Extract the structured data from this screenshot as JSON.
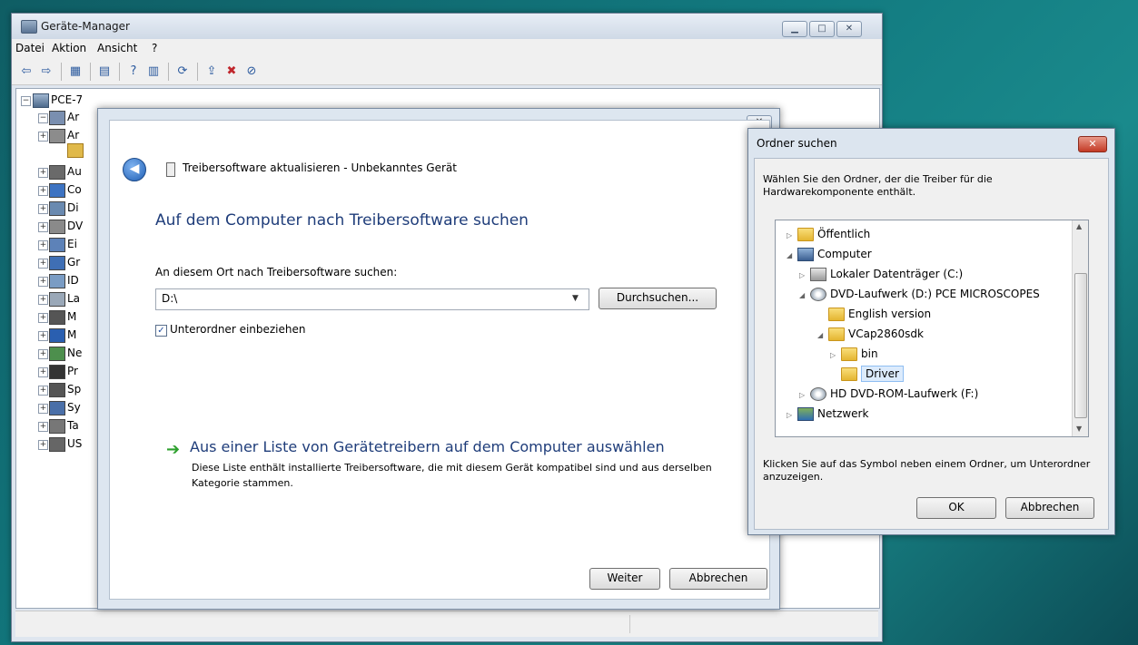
{
  "device_manager": {
    "title": "Geräte-Manager",
    "menu": [
      "Datei",
      "Aktion",
      "Ansicht",
      "?"
    ],
    "tree_root": "PCE-7",
    "tree_items": [
      "Ar",
      "Ar",
      "Au",
      "Co",
      "Di",
      "DV",
      "Ei",
      "Gr",
      "ID",
      "La",
      "M",
      "M",
      "Ne",
      "Pr",
      "Sp",
      "Sy",
      "Ta",
      "US"
    ]
  },
  "wizard": {
    "header": "Treibersoftware aktualisieren - Unbekanntes Gerät",
    "heading": "Auf dem Computer nach Treibersoftware suchen",
    "location_label": "An diesem Ort nach Treibersoftware suchen:",
    "path_value": "D:\\",
    "browse_label": "Durchsuchen...",
    "subfolders_label": "Unterordner einbeziehen",
    "subfolders_checked": true,
    "list_link": "Aus einer Liste von Gerätetreibern auf dem Computer auswählen",
    "list_desc": "Diese Liste enthält installierte Treibersoftware, die mit diesem Gerät kompatibel sind und aus derselben Kategorie stammen.",
    "next_label": "Weiter",
    "cancel_label": "Abbrechen"
  },
  "folder_dialog": {
    "title": "Ordner suchen",
    "description": "Wählen Sie den Ordner, der die Treiber für die Hardwarekomponente enthält.",
    "items": [
      {
        "label": "Öffentlich",
        "expander": "▷",
        "icon": "folder-icon"
      },
      {
        "label": "Computer",
        "expander": "◢",
        "icon": "computer-icon"
      },
      {
        "label": "Lokaler Datenträger (C:)",
        "expander": "▷",
        "icon": "drive-icon"
      },
      {
        "label": "DVD-Laufwerk (D:) PCE MICROSCOPES",
        "expander": "◢",
        "icon": "dvd-icon"
      },
      {
        "label": "English version",
        "expander": "",
        "icon": "folder-icon"
      },
      {
        "label": "VCap2860sdk",
        "expander": "◢",
        "icon": "folder-icon"
      },
      {
        "label": "bin",
        "expander": "▷",
        "icon": "folder-icon"
      },
      {
        "label": "Driver",
        "expander": "",
        "icon": "folder-icon",
        "selected": true
      },
      {
        "label": "HD DVD-ROM-Laufwerk (F:)",
        "expander": "▷",
        "icon": "dvd-icon"
      },
      {
        "label": "Netzwerk",
        "expander": "▷",
        "icon": "network-icon"
      }
    ],
    "hint": "Klicken Sie auf das Symbol neben einem Ordner, um Unterordner anzuzeigen.",
    "ok_label": "OK",
    "cancel_label": "Abbrechen"
  },
  "colors": {
    "heading_blue": "#1f3d7a",
    "selection": "#dcebfc",
    "close_red": "#c33a25"
  }
}
